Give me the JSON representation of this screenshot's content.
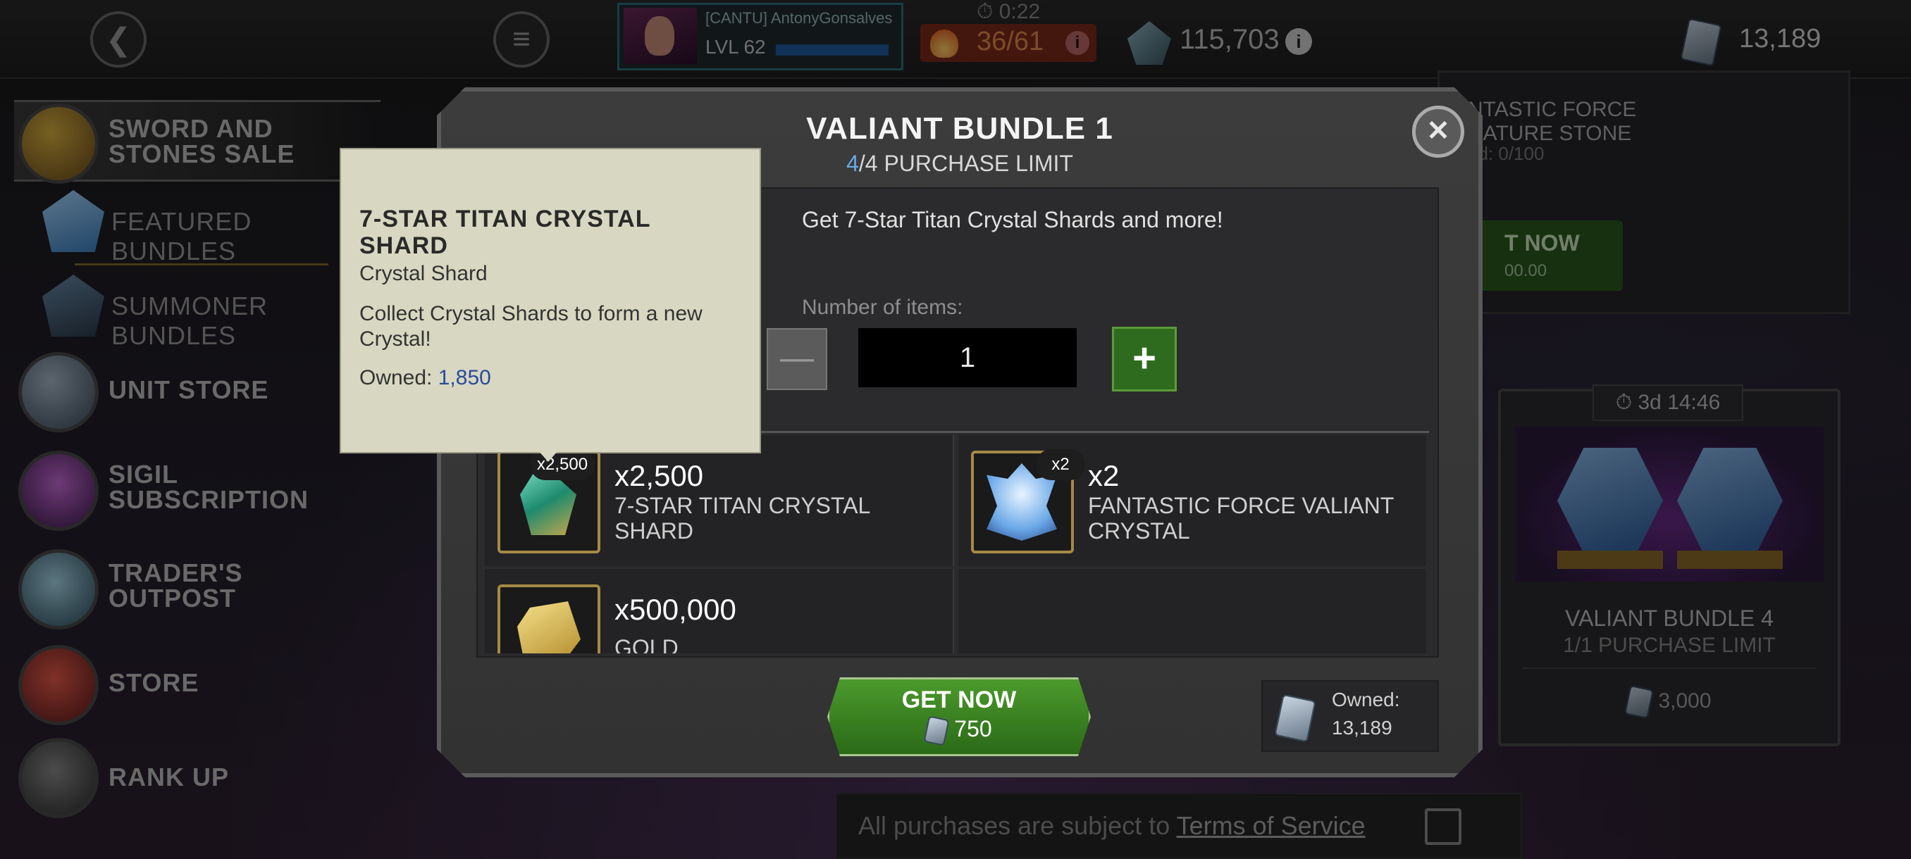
{
  "topbar": {
    "alliance_tag": "[CANTU] AntonyGonsalves",
    "level": "LVL 62",
    "timer": "0:22",
    "energy": "36/61",
    "gold": "115,703",
    "units": "13,189"
  },
  "sidebar": {
    "items": [
      {
        "label": "SWORD AND STONES SALE"
      },
      {
        "label": "FEATURED BUNDLES"
      },
      {
        "label": "SUMMONER BUNDLES"
      },
      {
        "label": "UNIT STORE"
      },
      {
        "label": "SIGIL SUBSCRIPTION"
      },
      {
        "label": "TRADER'S OUTPOST"
      },
      {
        "label": "STORE"
      },
      {
        "label": "RANK UP"
      }
    ]
  },
  "background_cards": {
    "top_right": {
      "title": "NTASTIC FORCE\nNATURE STONE",
      "owned": "ed: 0/100",
      "button_label": "T NOW",
      "button_price": "00.00"
    },
    "right": {
      "timer": "3d 14:46",
      "name": "VALIANT BUNDLE 4",
      "limit": "1/1 PURCHASE LIMIT",
      "price": "3,000"
    }
  },
  "footer": {
    "text": "All purchases are subject to ",
    "link": "Terms of Service"
  },
  "modal": {
    "title": "VALIANT BUNDLE 1",
    "limit_current": "4",
    "limit_rest": "/4 PURCHASE LIMIT",
    "description": "Get 7-Star Titan Crystal Shards and more!",
    "number_label": "Number of items:",
    "quantity": "1",
    "items": [
      {
        "badge": "x2,500",
        "qty": "x2,500",
        "name": "7-STAR TITAN CRYSTAL SHARD"
      },
      {
        "badge": "x2",
        "qty": "x2",
        "name": "FANTASTIC FORCE VALIANT CRYSTAL"
      },
      {
        "badge": "",
        "qty": "x500,000",
        "name": "GOLD"
      }
    ],
    "get_now": "GET NOW",
    "price": "750",
    "owned_label": "Owned:",
    "owned_value": "13,189"
  },
  "tooltip": {
    "title": "7-STAR TITAN CRYSTAL SHARD",
    "type": "Crystal Shard",
    "description": "Collect Crystal Shards to form a new Crystal!",
    "owned_label": "Owned: ",
    "owned_value": "1,850"
  },
  "colors": {
    "accent_blue": "#6aa8e8",
    "buy_green": "#2f6b1e",
    "tooltip_bg": "#d8d8c2"
  }
}
